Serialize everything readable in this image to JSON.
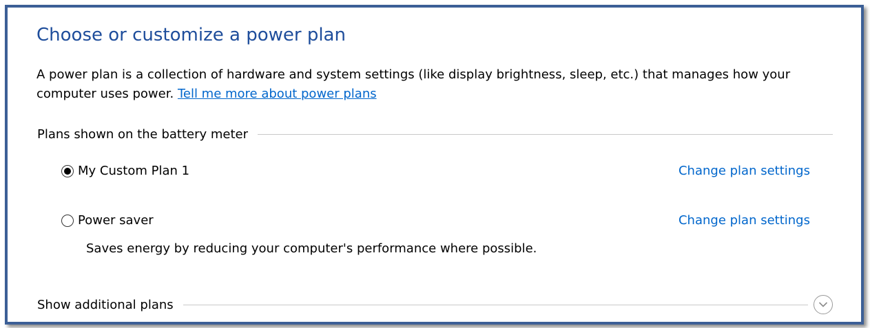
{
  "page": {
    "title": "Choose or customize a power plan",
    "description": "A power plan is a collection of hardware and system settings (like display brightness, sleep, etc.) that manages how your computer uses power.",
    "learn_more_link": "Tell me more about power plans"
  },
  "plans_group": {
    "header": "Plans shown on the battery meter",
    "plans": [
      {
        "name": "My Custom Plan 1",
        "selected": true,
        "change_link": "Change plan settings",
        "description": ""
      },
      {
        "name": "Power saver",
        "selected": false,
        "change_link": "Change plan settings",
        "description": "Saves energy by reducing your computer's performance where possible."
      }
    ]
  },
  "additional": {
    "header": "Show additional plans",
    "expand_icon": "chevron-down-circle-icon"
  },
  "colors": {
    "title": "#1e4d9b",
    "link": "#0066cc",
    "frame_border": "#3c5f96"
  }
}
